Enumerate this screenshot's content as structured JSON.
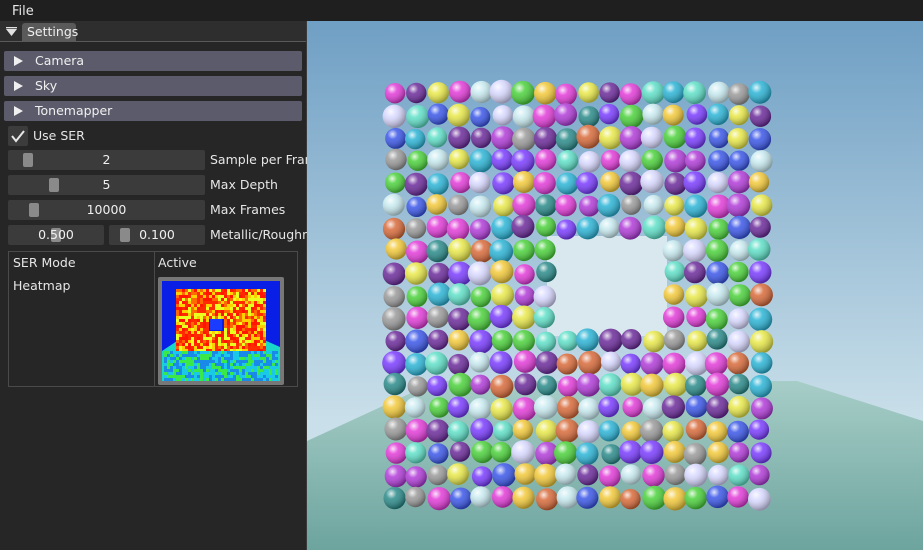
{
  "menu": {
    "file": "File"
  },
  "panel": {
    "tab": "Settings",
    "headers": [
      {
        "label": "Camera"
      },
      {
        "label": "Sky"
      },
      {
        "label": "Tonemapper"
      }
    ],
    "use_ser": {
      "label": "Use SER",
      "checked": true
    },
    "sliders": {
      "samples": {
        "value": "2",
        "label": "Sample per Frame"
      },
      "depth": {
        "value": "5",
        "label": "Max Depth"
      },
      "frames": {
        "value": "10000",
        "label": "Max Frames"
      },
      "metallic": {
        "value": "0.500"
      },
      "roughness": {
        "value": "0.100"
      },
      "metal_rough_label": "Metallic/Roughness"
    },
    "ser_table": {
      "mode_header": "SER Mode",
      "active_header": "Active",
      "mode_value": "Heatmap"
    }
  },
  "colors": {
    "header_bg": "#5b5b6b",
    "sky_top": "#6f9fc4",
    "floor": "#7fb3ad",
    "heat_bg": "#0a1fe6"
  }
}
